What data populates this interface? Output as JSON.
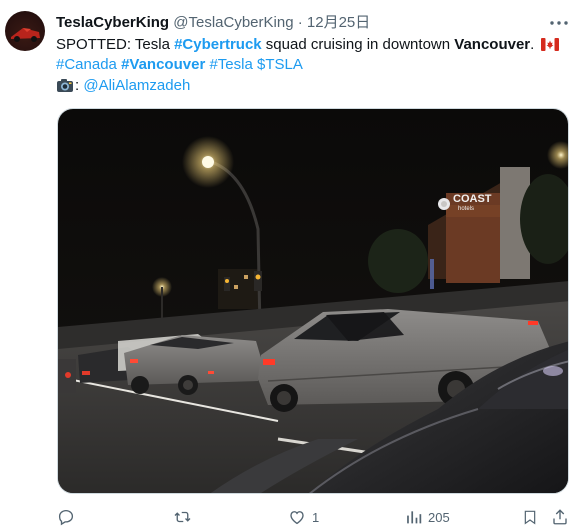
{
  "tweet": {
    "display_name": "TeslaCyberKing",
    "handle": "@TeslaCyberKing",
    "separator": "·",
    "date": "12月25日",
    "line1": {
      "prefix": "SPOTTED: Tesla ",
      "tag_cybertruck": "#Cybertruck",
      "middle": " squad cruising in downtown ",
      "bold_city": "Vancouver",
      "suffix": "."
    },
    "line2": {
      "tag_canada": "#Canada",
      "tag_vancouver": "#Vancouver",
      "tag_tesla": "#Tesla",
      "cashtag": "$TSLA"
    },
    "line3": {
      "colon": ":",
      "mention": "@AliAlamzadeh"
    },
    "image": {
      "sign_text": "COAST",
      "sign_subtext": "hotels"
    }
  },
  "actions": {
    "reply_count": "",
    "retweet_count": "",
    "like_count": "1",
    "views_count": "205"
  },
  "icons": {
    "more": "more-dots-icon",
    "flag": "canada-flag-icon",
    "camera": "camera-icon",
    "reply": "reply-icon",
    "retweet": "retweet-icon",
    "like": "heart-icon",
    "views": "views-icon",
    "bookmark": "bookmark-icon",
    "share": "share-icon"
  },
  "colors": {
    "link": "#1d9bf0",
    "secondary": "#536471",
    "text": "#0f1419"
  }
}
